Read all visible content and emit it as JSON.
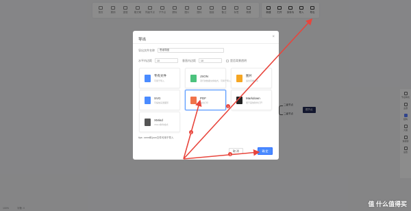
{
  "toolbar": {
    "left_items": [
      {
        "icon": "home-icon",
        "label": "首页"
      },
      {
        "icon": "undo-icon",
        "label": "撤销"
      },
      {
        "icon": "redo-icon",
        "label": "重做"
      },
      {
        "icon": "format-icon",
        "label": "格式刷"
      },
      {
        "icon": "node-icon",
        "label": "同级节点"
      },
      {
        "icon": "child-icon",
        "label": "子节点"
      },
      {
        "icon": "delete-icon",
        "label": "删除"
      },
      {
        "icon": "image-icon",
        "label": "图片"
      },
      {
        "icon": "icon-icon",
        "label": "图标"
      },
      {
        "icon": "link-icon",
        "label": "链接"
      },
      {
        "icon": "note-icon",
        "label": "备注"
      },
      {
        "icon": "tag-icon",
        "label": "标签"
      },
      {
        "icon": "summary-icon",
        "label": "概要"
      }
    ],
    "right_items": [
      {
        "icon": "new-icon",
        "label": "新建"
      },
      {
        "icon": "open-icon",
        "label": "打开"
      },
      {
        "icon": "save-icon",
        "label": "另存为"
      },
      {
        "icon": "import-icon",
        "label": "导入"
      },
      {
        "icon": "export-icon",
        "label": "导出"
      }
    ]
  },
  "side_panel": {
    "items": [
      {
        "icon": "style-icon",
        "label": "节点样式"
      },
      {
        "icon": "theme-icon",
        "label": "主题"
      },
      {
        "icon": "structure-icon",
        "label": "结构"
      },
      {
        "icon": "outline-icon",
        "label": "大纲"
      },
      {
        "icon": "shortcut-icon",
        "label": "快捷键"
      },
      {
        "icon": "setting-icon",
        "label": "设置"
      }
    ]
  },
  "mindmap": {
    "root": "根节点",
    "children": [
      "二级节点",
      "二级节点"
    ]
  },
  "statusbar": {
    "zoom": "100%",
    "count": "字数: 0"
  },
  "watermark": "值 什么值得买",
  "dialog": {
    "title": "导出",
    "close": "×",
    "filename_label": "导出文件名称",
    "filename_value": "思维导图",
    "padding_h_label": "水平内边距",
    "padding_h_value": "10",
    "padding_v_label": "垂直内边距",
    "padding_v_value": "10",
    "transparent_label": "是否背景透明",
    "formats": [
      {
        "name": "专有文件",
        "desc": "可用于导入",
        "color": "#4a8bff",
        "icon": "file-icon"
      },
      {
        "name": "JSON",
        "desc": "流行的数据交换格式，可用于导入",
        "color": "#4bc27d",
        "icon": "json-icon"
      },
      {
        "name": "图片",
        "desc": "适合查看分享",
        "color": "#f5a623",
        "icon": "picture-icon"
      },
      {
        "name": "SVG",
        "desc": "可缩放矢量图形",
        "color": "#4a8bff",
        "icon": "svg-icon"
      },
      {
        "name": "PDF",
        "desc": "适合打印",
        "color": "#f0734a",
        "icon": "pdf-icon"
      },
      {
        "name": "Markdown",
        "desc": "便于其他软件打开",
        "color": "#222222",
        "icon": "markdown-icon"
      },
      {
        "name": "XMind",
        "desc": "XMind软件格式",
        "color": "#555555",
        "icon": "xmind-icon"
      }
    ],
    "tips": "tips: .smm和.json文件可用于导入",
    "cancel": "取 消",
    "confirm": "确 定"
  },
  "annotations": [
    "1",
    "2",
    "3"
  ],
  "colors": {
    "accent": "#4a8bff",
    "annotation": "#e8453c",
    "root_node": "#232b55"
  }
}
